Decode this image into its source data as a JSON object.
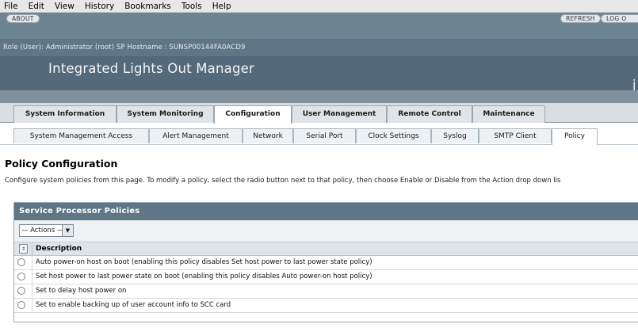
{
  "menubar": {
    "items": [
      {
        "label": "File"
      },
      {
        "label": "Edit"
      },
      {
        "label": "View"
      },
      {
        "label": "History"
      },
      {
        "label": "Bookmarks"
      },
      {
        "label": "Tools"
      },
      {
        "label": "Help"
      }
    ]
  },
  "masthead": {
    "about_label": "ABOUT",
    "refresh_label": "REFRESH",
    "logout_label": "LOG O",
    "role_line": "Role (User): Administrator (root)   SP Hostname : SUNSP00144FA0ACD9",
    "app_title": "Integrated Lights Out Manager",
    "brand_glyph": "j"
  },
  "tabs": [
    {
      "label": "System Information"
    },
    {
      "label": "System Monitoring"
    },
    {
      "label": "Configuration",
      "active": true
    },
    {
      "label": "User Management"
    },
    {
      "label": "Remote Control"
    },
    {
      "label": "Maintenance"
    }
  ],
  "subtabs": [
    {
      "label": "System Management Access"
    },
    {
      "label": "Alert Management"
    },
    {
      "label": "Network"
    },
    {
      "label": "Serial Port"
    },
    {
      "label": "Clock Settings"
    },
    {
      "label": "Syslog"
    },
    {
      "label": "SMTP Client"
    },
    {
      "label": "Policy",
      "active": true
    }
  ],
  "page": {
    "title": "Policy Configuration",
    "description": "Configure system policies from this page. To modify a policy, select the radio button next to that policy, then choose Enable or Disable from the Action drop down lis"
  },
  "table": {
    "title": "Service Processor Policies",
    "actions_label": "— Actions —",
    "column_description": "Description",
    "rows": [
      {
        "description": "Auto power-on host on boot (enabling this policy disables Set host power to last power state policy)"
      },
      {
        "description": "Set host power to last power state on boot (enabling this policy disables Auto power-on host policy)"
      },
      {
        "description": "Set to delay host power on"
      },
      {
        "description": "Set to enable backing up of user account info to SCC card"
      }
    ]
  },
  "colors": {
    "masthead": "#5e7685",
    "table_header": "#5f7686",
    "tab_bar": "#d7dde1"
  }
}
